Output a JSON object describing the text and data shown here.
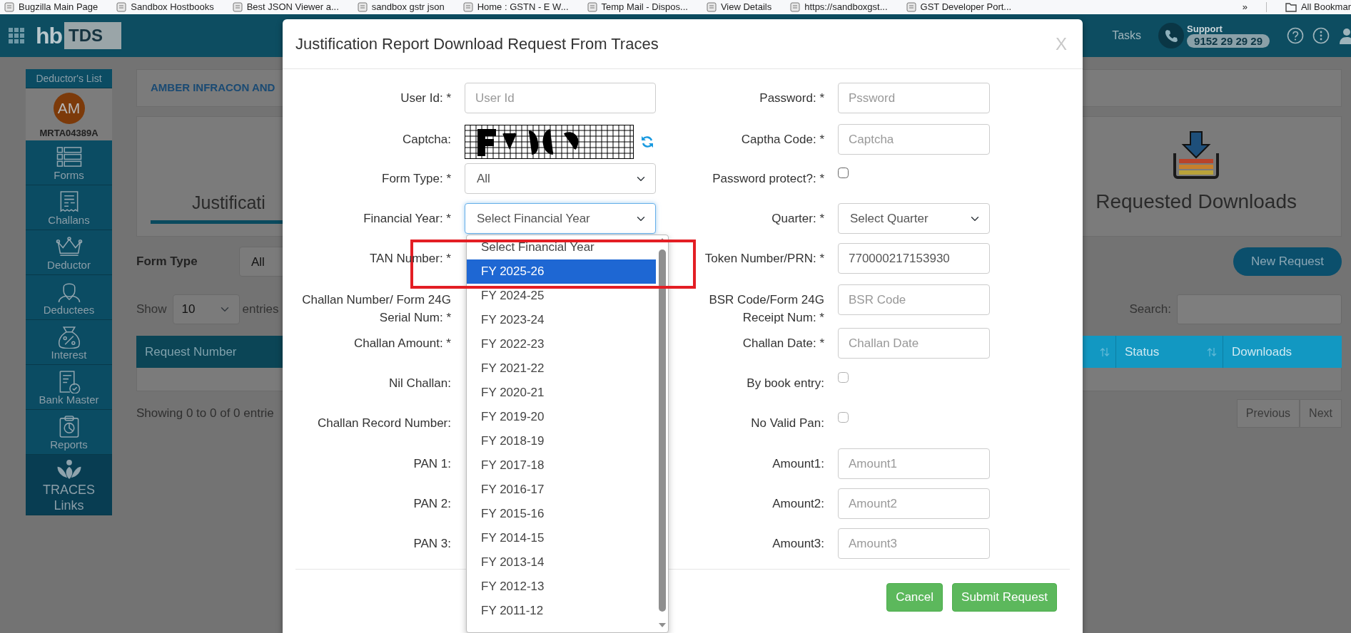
{
  "bookmarks": {
    "items": [
      {
        "label": "Bugzilla Main Page"
      },
      {
        "label": "Sandbox Hostbooks"
      },
      {
        "label": "Best JSON Viewer a..."
      },
      {
        "label": "sandbox gstr json"
      },
      {
        "label": "Home : GSTN - E W..."
      },
      {
        "label": "Temp Mail - Dispos..."
      },
      {
        "label": "View Details"
      },
      {
        "label": "https://sandboxgst..."
      },
      {
        "label": "GST Developer Port..."
      }
    ],
    "overflow": "»",
    "all": "All Bookmar"
  },
  "header": {
    "logo_mark": "hb",
    "logo_product": "TDS",
    "tasks": "Tasks",
    "support_label": "Support",
    "support_phone": "9152 29 29 29"
  },
  "sidebar": {
    "title": "Deductor's List",
    "deductor": {
      "initials": "AM",
      "id": "MRTA04389A"
    },
    "items": [
      {
        "label": "Forms",
        "kind": "forms",
        "selected": false
      },
      {
        "label": "Challans",
        "kind": "receipt",
        "selected": false
      },
      {
        "label": "Deductor",
        "kind": "crown",
        "selected": false
      },
      {
        "label": "Deductees",
        "kind": "person",
        "selected": false
      },
      {
        "label": "Interest",
        "kind": "bag",
        "selected": false
      },
      {
        "label": "Bank Master",
        "kind": "document",
        "selected": false
      },
      {
        "label": "Reports",
        "kind": "clipboard",
        "selected": false
      },
      {
        "label": "TRACES Links",
        "kind": "lotus",
        "selected": true
      }
    ]
  },
  "page": {
    "company": "AMBER INFRACON AND",
    "tabs": [
      {
        "label": "Justificati",
        "selected": true
      },
      {
        "label": "Requested Downloads",
        "selected": false
      }
    ],
    "form_type": {
      "label": "Form Type",
      "value": "All"
    },
    "new_request": "New Request",
    "length": {
      "prefix": "Show",
      "value": "10",
      "suffix": "entries"
    },
    "search": {
      "label": "Search:"
    },
    "table": {
      "columns": [
        {
          "label": "Request Number",
          "sortable": false
        },
        {
          "sortable": true
        },
        {
          "label": "Status",
          "sortable": true
        },
        {
          "label": "Downloads",
          "sortable": false
        }
      ]
    },
    "info": "Showing 0 to 0 of 0 entrie",
    "pagination": [
      {
        "label": "Previous"
      },
      {
        "label": "Next"
      }
    ]
  },
  "modal": {
    "title": "Justification Report Download Request From Traces",
    "close": "X",
    "left_fields": [
      {
        "label": "User Id: *",
        "kind": "text",
        "placeholder": "User Id"
      },
      {
        "label": "Captcha:",
        "kind": "captcha"
      },
      {
        "label": "Form Type: *",
        "kind": "select",
        "value": "All",
        "open": false
      },
      {
        "label": "Financial Year: *",
        "kind": "select",
        "value": "Select Financial Year",
        "open": true
      },
      {
        "label": "TAN Number: *",
        "kind": "covered"
      },
      {
        "label": "Challan Number/ Form 24G Serial Num: *",
        "kind": "covered"
      },
      {
        "label": "Challan Amount: *",
        "kind": "covered"
      },
      {
        "label": "Nil Challan:",
        "kind": "covered"
      },
      {
        "label": "Challan Record Number:",
        "kind": "covered"
      },
      {
        "label": "PAN 1:",
        "kind": "covered"
      },
      {
        "label": "PAN 2:",
        "kind": "covered"
      },
      {
        "label": "PAN 3:",
        "kind": "covered"
      }
    ],
    "right_fields": [
      {
        "label": "Password: *",
        "kind": "text",
        "placeholder": "Pssword"
      },
      {
        "label": "Captha Code: *",
        "kind": "text",
        "placeholder": "Captcha"
      },
      {
        "label": "Password protect?: *",
        "kind": "checkbox",
        "checked": false,
        "disabled": false
      },
      {
        "label": "Quarter: *",
        "kind": "select",
        "value": "Select Quarter",
        "open": false
      },
      {
        "label": "Token Number/PRN: *",
        "kind": "text",
        "value": "770000217153930"
      },
      {
        "label": "BSR Code/Form 24G Receipt Num: *",
        "kind": "text",
        "placeholder": "BSR Code"
      },
      {
        "label": "Challan Date: *",
        "kind": "text",
        "placeholder": "Challan Date"
      },
      {
        "label": "By book entry:",
        "kind": "checkbox",
        "checked": false,
        "disabled": true
      },
      {
        "label": "No Valid Pan:",
        "kind": "checkbox",
        "checked": false,
        "disabled": true
      },
      {
        "label": "Amount1:",
        "kind": "text",
        "placeholder": "Amount1"
      },
      {
        "label": "Amount2:",
        "kind": "text",
        "placeholder": "Amount2"
      },
      {
        "label": "Amount3:",
        "kind": "text",
        "placeholder": "Amount3"
      }
    ],
    "dropdown": {
      "options": [
        {
          "label": "Select Financial Year",
          "selected": false
        },
        {
          "label": "FY 2025-26",
          "selected": true
        },
        {
          "label": "FY 2024-25",
          "selected": false
        },
        {
          "label": "FY 2023-24",
          "selected": false
        },
        {
          "label": "FY 2022-23",
          "selected": false
        },
        {
          "label": "FY 2021-22",
          "selected": false
        },
        {
          "label": "FY 2020-21",
          "selected": false
        },
        {
          "label": "FY 2019-20",
          "selected": false
        },
        {
          "label": "FY 2018-19",
          "selected": false
        },
        {
          "label": "FY 2017-18",
          "selected": false
        },
        {
          "label": "FY 2016-17",
          "selected": false
        },
        {
          "label": "FY 2015-16",
          "selected": false
        },
        {
          "label": "FY 2014-15",
          "selected": false
        },
        {
          "label": "FY 2013-14",
          "selected": false
        },
        {
          "label": "FY 2012-13",
          "selected": false
        },
        {
          "label": "FY 2011-12",
          "selected": false
        }
      ]
    },
    "buttons": [
      {
        "label": "Cancel"
      },
      {
        "label": "Submit Request"
      }
    ]
  },
  "annotations": [
    {
      "kind": "rectangle",
      "color": "#e31e24"
    }
  ]
}
